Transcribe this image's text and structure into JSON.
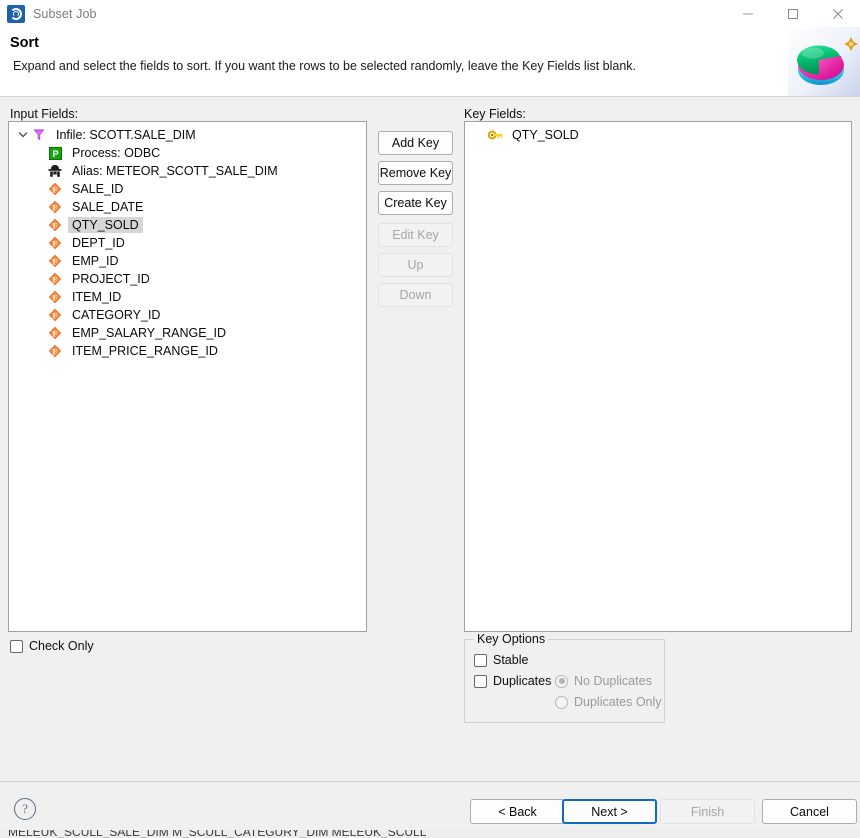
{
  "window": {
    "title": "Subset Job",
    "app_icon": "app-logo-icon",
    "controls": {
      "minimize": "minimize-icon",
      "maximize": "maximize-icon",
      "close": "close-icon"
    }
  },
  "header": {
    "title": "Sort",
    "description": "Expand and select the fields to sort. If you want the rows to be selected randomly, leave the Key Fields list blank.",
    "graphic": "pie-sphere-logo-icon",
    "graphic_colors": {
      "green": "#06b86d",
      "magenta": "#e8189c",
      "cyan": "#2fc6ef",
      "star": "#e2a020"
    }
  },
  "left_panel": {
    "label": "Input Fields:",
    "tree": [
      {
        "level": 1,
        "icon": "funnel-icon",
        "label": "Infile: SCOTT.SALE_DIM",
        "expanded": true,
        "selected": false
      },
      {
        "level": 2,
        "icon": "process-icon",
        "label": "Process: ODBC",
        "expanded": null,
        "selected": false
      },
      {
        "level": 2,
        "icon": "alias-icon",
        "label": "Alias: METEOR_SCOTT_SALE_DIM",
        "expanded": null,
        "selected": false
      },
      {
        "level": 2,
        "icon": "field-icon",
        "label": "SALE_ID",
        "expanded": null,
        "selected": false
      },
      {
        "level": 2,
        "icon": "field-icon",
        "label": "SALE_DATE",
        "expanded": null,
        "selected": false
      },
      {
        "level": 2,
        "icon": "field-icon",
        "label": "QTY_SOLD",
        "expanded": null,
        "selected": true
      },
      {
        "level": 2,
        "icon": "field-icon",
        "label": "DEPT_ID",
        "expanded": null,
        "selected": false
      },
      {
        "level": 2,
        "icon": "field-icon",
        "label": "EMP_ID",
        "expanded": null,
        "selected": false
      },
      {
        "level": 2,
        "icon": "field-icon",
        "label": "PROJECT_ID",
        "expanded": null,
        "selected": false
      },
      {
        "level": 2,
        "icon": "field-icon",
        "label": "ITEM_ID",
        "expanded": null,
        "selected": false
      },
      {
        "level": 2,
        "icon": "field-icon",
        "label": "CATEGORY_ID",
        "expanded": null,
        "selected": false
      },
      {
        "level": 2,
        "icon": "field-icon",
        "label": "EMP_SALARY_RANGE_ID",
        "expanded": null,
        "selected": false
      },
      {
        "level": 2,
        "icon": "field-icon",
        "label": "ITEM_PRICE_RANGE_ID",
        "expanded": null,
        "selected": false
      }
    ],
    "check_only": {
      "label": "Check Only",
      "checked": false
    }
  },
  "mid_buttons": [
    {
      "label": "Add Key",
      "enabled": true
    },
    {
      "label": "Remove Key",
      "enabled": true
    },
    {
      "label": "Create Key",
      "enabled": true
    },
    {
      "label": "Edit Key",
      "enabled": false
    },
    {
      "label": "Up",
      "enabled": false
    },
    {
      "label": "Down",
      "enabled": false
    }
  ],
  "right_panel": {
    "label": "Key Fields:",
    "items": [
      {
        "icon": "key-icon",
        "label": "QTY_SOLD"
      }
    ]
  },
  "key_options": {
    "title": "Key Options",
    "stable": {
      "label": "Stable",
      "checked": false
    },
    "duplicates": {
      "label": "Duplicates",
      "checked": false
    },
    "radios": [
      {
        "label": "No Duplicates",
        "checked": true,
        "enabled": false
      },
      {
        "label": "Duplicates Only",
        "checked": false,
        "enabled": false
      }
    ]
  },
  "footer": {
    "help_icon": "help-icon",
    "buttons": [
      {
        "label": "< Back",
        "enabled": true,
        "default": false
      },
      {
        "label": "Next >",
        "enabled": true,
        "default": true
      },
      {
        "label": "Finish",
        "enabled": false,
        "default": false
      },
      {
        "label": "Cancel",
        "enabled": true,
        "default": false
      }
    ]
  },
  "background_sliver": {
    "text": "MELEUK_SCULL_SALE_DIM    M_SCULL_CATEGURY_DIM    MELEUK_SCULL"
  }
}
